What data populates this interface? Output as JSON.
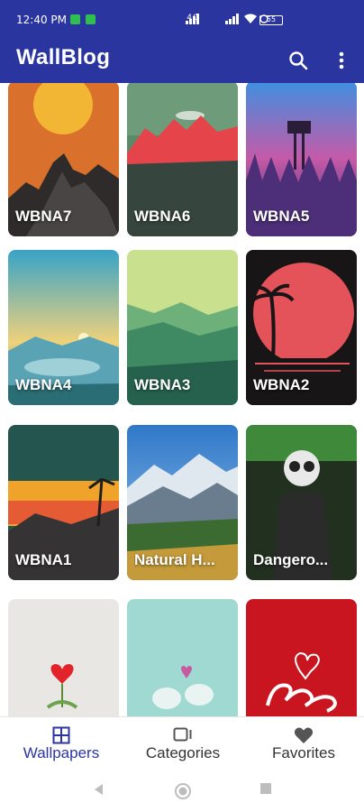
{
  "status_bar": {
    "time": "12:40 PM",
    "network_text": "4G",
    "battery": "55"
  },
  "app_bar": {
    "title": "WallBlog",
    "search_icon": "search-icon",
    "menu_icon": "more-vert-icon"
  },
  "wallpapers": [
    {
      "label": "WBNA7"
    },
    {
      "label": "WBNA6"
    },
    {
      "label": "WBNA5"
    },
    {
      "label": "WBNA4"
    },
    {
      "label": "WBNA3"
    },
    {
      "label": "WBNA2"
    },
    {
      "label": "WBNA1"
    },
    {
      "label": "Natural H..."
    },
    {
      "label": "Dangero..."
    },
    {
      "label": ""
    },
    {
      "label": ""
    },
    {
      "label": ""
    }
  ],
  "bottom_nav": {
    "items": [
      {
        "label": "Wallpapers",
        "icon": "grid-icon",
        "active": true
      },
      {
        "label": "Categories",
        "icon": "categories-icon",
        "active": false
      },
      {
        "label": "Favorites",
        "icon": "heart-icon",
        "active": false
      }
    ]
  },
  "colors": {
    "primary": "#2b35a0",
    "nav_active": "#2b35a0"
  }
}
